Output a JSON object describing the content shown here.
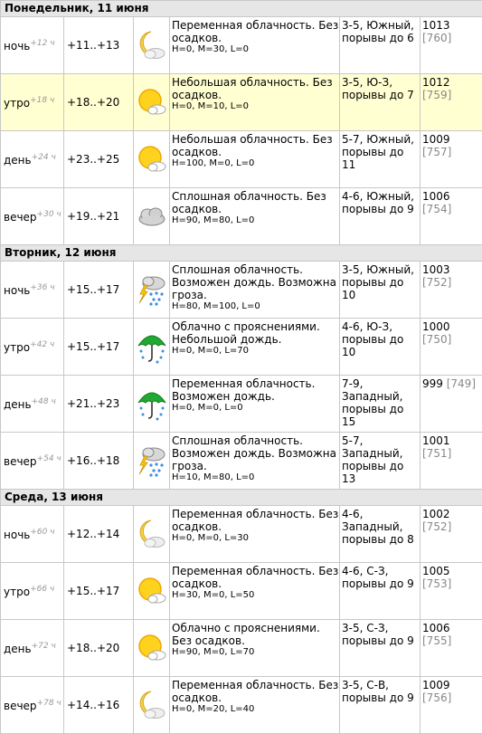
{
  "days": [
    {
      "title": "Понедельник, 11 июня",
      "rows": [
        {
          "time": "ночь",
          "offset": "+12 ч",
          "temp": "+11..+13",
          "icon": "moon-cloud-icon",
          "desc": "Переменная облачность. Без осадков.",
          "hml": "H=0, M=30, L=0",
          "wind": "3-5, Южный, порывы до 6",
          "pressure": "1013",
          "pressure_mm": "[760]"
        },
        {
          "time": "утро",
          "offset": "+18 ч",
          "temp": "+18..+20",
          "icon": "sun-cloud-icon",
          "desc": "Небольшая облачность. Без осадков.",
          "hml": "H=0, M=10, L=0",
          "wind": "3-5, Ю-З, порывы до 7",
          "pressure": "1012",
          "pressure_mm": "[759]"
        },
        {
          "time": "день",
          "offset": "+24 ч",
          "temp": "+23..+25",
          "icon": "sun-cloud-icon",
          "desc": "Небольшая облачность. Без осадков.",
          "hml": "H=100, M=0, L=0",
          "wind": "5-7, Южный, порывы до 11",
          "pressure": "1009",
          "pressure_mm": "[757]"
        },
        {
          "time": "вечер",
          "offset": "+30 ч",
          "temp": "+19..+21",
          "icon": "cloud-icon",
          "desc": "Сплошная облачность. Без осадков.",
          "hml": "H=90, M=80, L=0",
          "wind": "4-6, Южный, порывы до 9",
          "pressure": "1006",
          "pressure_mm": "[754]"
        }
      ]
    },
    {
      "title": "Вторник, 12 июня",
      "rows": [
        {
          "time": "ночь",
          "offset": "+36 ч",
          "temp": "+15..+17",
          "icon": "thunderstorm-icon",
          "desc": "Сплошная облачность. Возможен дождь. Возможна гроза.",
          "hml": "H=80, M=100, L=0",
          "wind": "3-5, Южный, порывы до 10",
          "pressure": "1003",
          "pressure_mm": "[752]"
        },
        {
          "time": "утро",
          "offset": "+42 ч",
          "temp": "+15..+17",
          "icon": "umbrella-rain-icon",
          "desc": "Облачно с прояснениями. Небольшой дождь.",
          "hml": "H=0, M=0, L=70",
          "wind": "4-6, Ю-З, порывы до 10",
          "pressure": "1000",
          "pressure_mm": "[750]"
        },
        {
          "time": "день",
          "offset": "+48 ч",
          "temp": "+21..+23",
          "icon": "umbrella-rain-icon",
          "desc": "Переменная облачность. Возможен дождь.",
          "hml": "H=0, M=0, L=0",
          "wind": "7-9, Западный, порывы до 15",
          "pressure": "999",
          "pressure_mm": "[749]"
        },
        {
          "time": "вечер",
          "offset": "+54 ч",
          "temp": "+16..+18",
          "icon": "thunderstorm-icon",
          "desc": "Сплошная облачность. Возможен дождь. Возможна гроза.",
          "hml": "H=10, M=80, L=0",
          "wind": "5-7, Западный, порывы до 13",
          "pressure": "1001",
          "pressure_mm": "[751]"
        }
      ]
    },
    {
      "title": "Среда, 13 июня",
      "rows": [
        {
          "time": "ночь",
          "offset": "+60 ч",
          "temp": "+12..+14",
          "icon": "moon-cloud-icon",
          "desc": "Переменная облачность. Без осадков.",
          "hml": "H=0, M=0, L=30",
          "wind": "4-6, Западный, порывы до 8",
          "pressure": "1002",
          "pressure_mm": "[752]"
        },
        {
          "time": "утро",
          "offset": "+66 ч",
          "temp": "+15..+17",
          "icon": "sun-cloud-icon",
          "desc": "Переменная облачность. Без осадков.",
          "hml": "H=30, M=0, L=50",
          "wind": "4-6, С-З, порывы до 9",
          "pressure": "1005",
          "pressure_mm": "[753]"
        },
        {
          "time": "день",
          "offset": "+72 ч",
          "temp": "+18..+20",
          "icon": "sun-cloud-icon",
          "desc": "Облачно с прояснениями. Без осадков.",
          "hml": "H=90, M=0, L=70",
          "wind": "3-5, С-З, порывы до 9",
          "pressure": "1006",
          "pressure_mm": "[755]"
        },
        {
          "time": "вечер",
          "offset": "+78 ч",
          "temp": "+14..+16",
          "icon": "moon-cloud-icon",
          "desc": "Переменная облачность. Без осадков.",
          "hml": "H=0, M=20, L=40",
          "wind": "3-5, С-В, порывы до 9",
          "pressure": "1009",
          "pressure_mm": "[756]"
        }
      ]
    }
  ],
  "highlight_color": "#ffffd2",
  "header_color": "#e6e6e6"
}
